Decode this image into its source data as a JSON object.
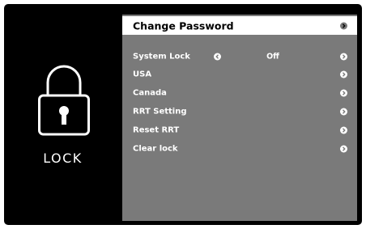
{
  "left_panel": {
    "icon": "lock-icon",
    "label": "LOCK"
  },
  "menu": {
    "items": [
      {
        "label": "Change Password",
        "selected": true,
        "right_icon": "chevron-right-icon"
      },
      {
        "label": "System Lock",
        "value": "Off",
        "left_icon": "chevron-left-icon",
        "right_icon": "chevron-right-icon"
      },
      {
        "label": "USA",
        "right_icon": "chevron-right-icon"
      },
      {
        "label": "Canada",
        "right_icon": "chevron-right-icon"
      },
      {
        "label": "RRT Setting",
        "right_icon": "chevron-right-icon"
      },
      {
        "label": "Reset RRT",
        "right_icon": "chevron-right-icon"
      },
      {
        "label": "Clear lock",
        "right_icon": "chevron-right-icon"
      }
    ]
  },
  "colors": {
    "screen_bg": "#000000",
    "menu_bg": "#7a7a7a",
    "selected_bg": "#ffffff",
    "text": "#ffffff",
    "selected_text": "#000000"
  }
}
